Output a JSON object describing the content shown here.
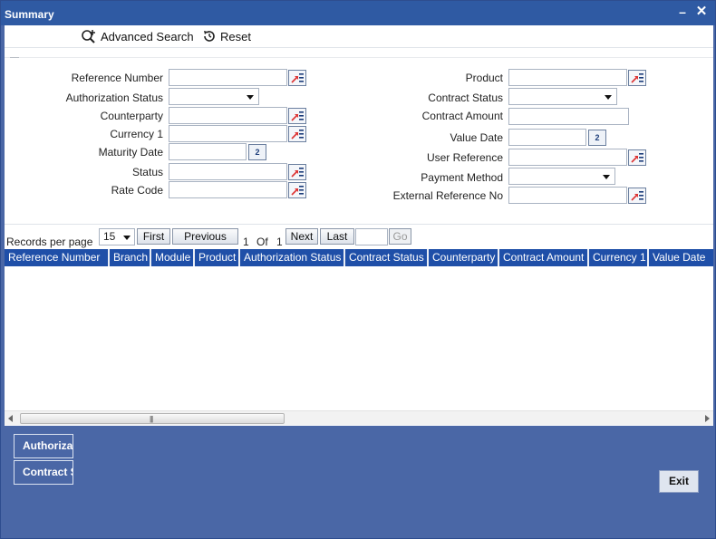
{
  "window": {
    "title": "Summary"
  },
  "toolbar": {
    "advanced_search": "Advanced Search",
    "reset": "Reset"
  },
  "form": {
    "left": [
      {
        "label": "Reference Number",
        "type": "lov"
      },
      {
        "label": "Authorization Status",
        "type": "select"
      },
      {
        "label": "Counterparty",
        "type": "lov"
      },
      {
        "label": "Currency 1",
        "type": "lov"
      },
      {
        "label": "Maturity Date",
        "type": "date"
      },
      {
        "label": "Status",
        "type": "lov"
      },
      {
        "label": "Rate Code",
        "type": "lov"
      }
    ],
    "right": [
      {
        "label": "Product",
        "type": "lov"
      },
      {
        "label": "Contract Status",
        "type": "select"
      },
      {
        "label": "Contract Amount",
        "type": "text"
      },
      {
        "label": "Value Date",
        "type": "date"
      },
      {
        "label": "User Reference",
        "type": "lov"
      },
      {
        "label": "Payment Method",
        "type": "select"
      },
      {
        "label": "External Reference No",
        "type": "lov"
      }
    ]
  },
  "pagination": {
    "records_per_page_label": "Records per page",
    "records_per_page": "15",
    "first": "First",
    "previous": "Previous",
    "current_page": "1",
    "of": "Of",
    "total_pages": "1",
    "next": "Next",
    "last": "Last",
    "go": "Go"
  },
  "grid": {
    "columns": [
      "Reference Number",
      "Branch",
      "Module",
      "Product",
      "Authorization Status",
      "Contract Status",
      "Counterparty",
      "Contract Amount",
      "Currency 1",
      "Value Date"
    ],
    "rows": []
  },
  "footer": {
    "buttons": [
      "Authorization Status",
      "Contract Status"
    ],
    "exit": "Exit"
  },
  "colors": {
    "titlebar": "#2f5aa3",
    "frame": "#4a67a6",
    "grid_header": "#1f4fa8"
  },
  "icons": {
    "lov": "list-of-values-icon",
    "calendar": "calendar-icon",
    "advanced_search": "advanced-search-icon",
    "reset": "reset-icon"
  }
}
